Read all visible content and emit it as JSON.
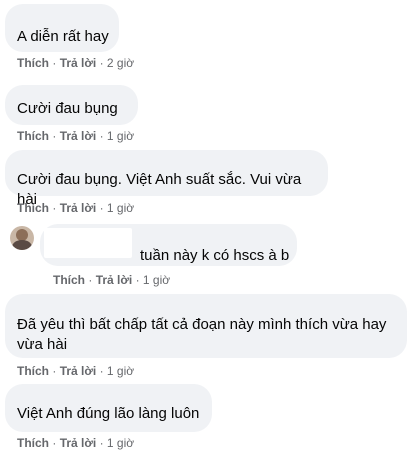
{
  "labels": {
    "like": "Thích",
    "reply": "Trả lời",
    "dot": "·"
  },
  "comments": [
    {
      "text": "A diễn rất hay",
      "time": "2 giờ"
    },
    {
      "text": "Cười đau bụng",
      "time": "1 giờ"
    },
    {
      "text": "Cười đau bụng. Việt Anh suất sắc. Vui vừa hài",
      "time": "1 giờ"
    },
    {
      "text": "tuần này k có hscs à b",
      "time": "1 giờ"
    },
    {
      "text": "Đã yêu thì bất chấp tất cả đoạn này mình thích vừa hay vừa hài",
      "time": "1 giờ"
    },
    {
      "text": "Việt Anh đúng lão làng luôn",
      "time": "1 giờ"
    }
  ]
}
